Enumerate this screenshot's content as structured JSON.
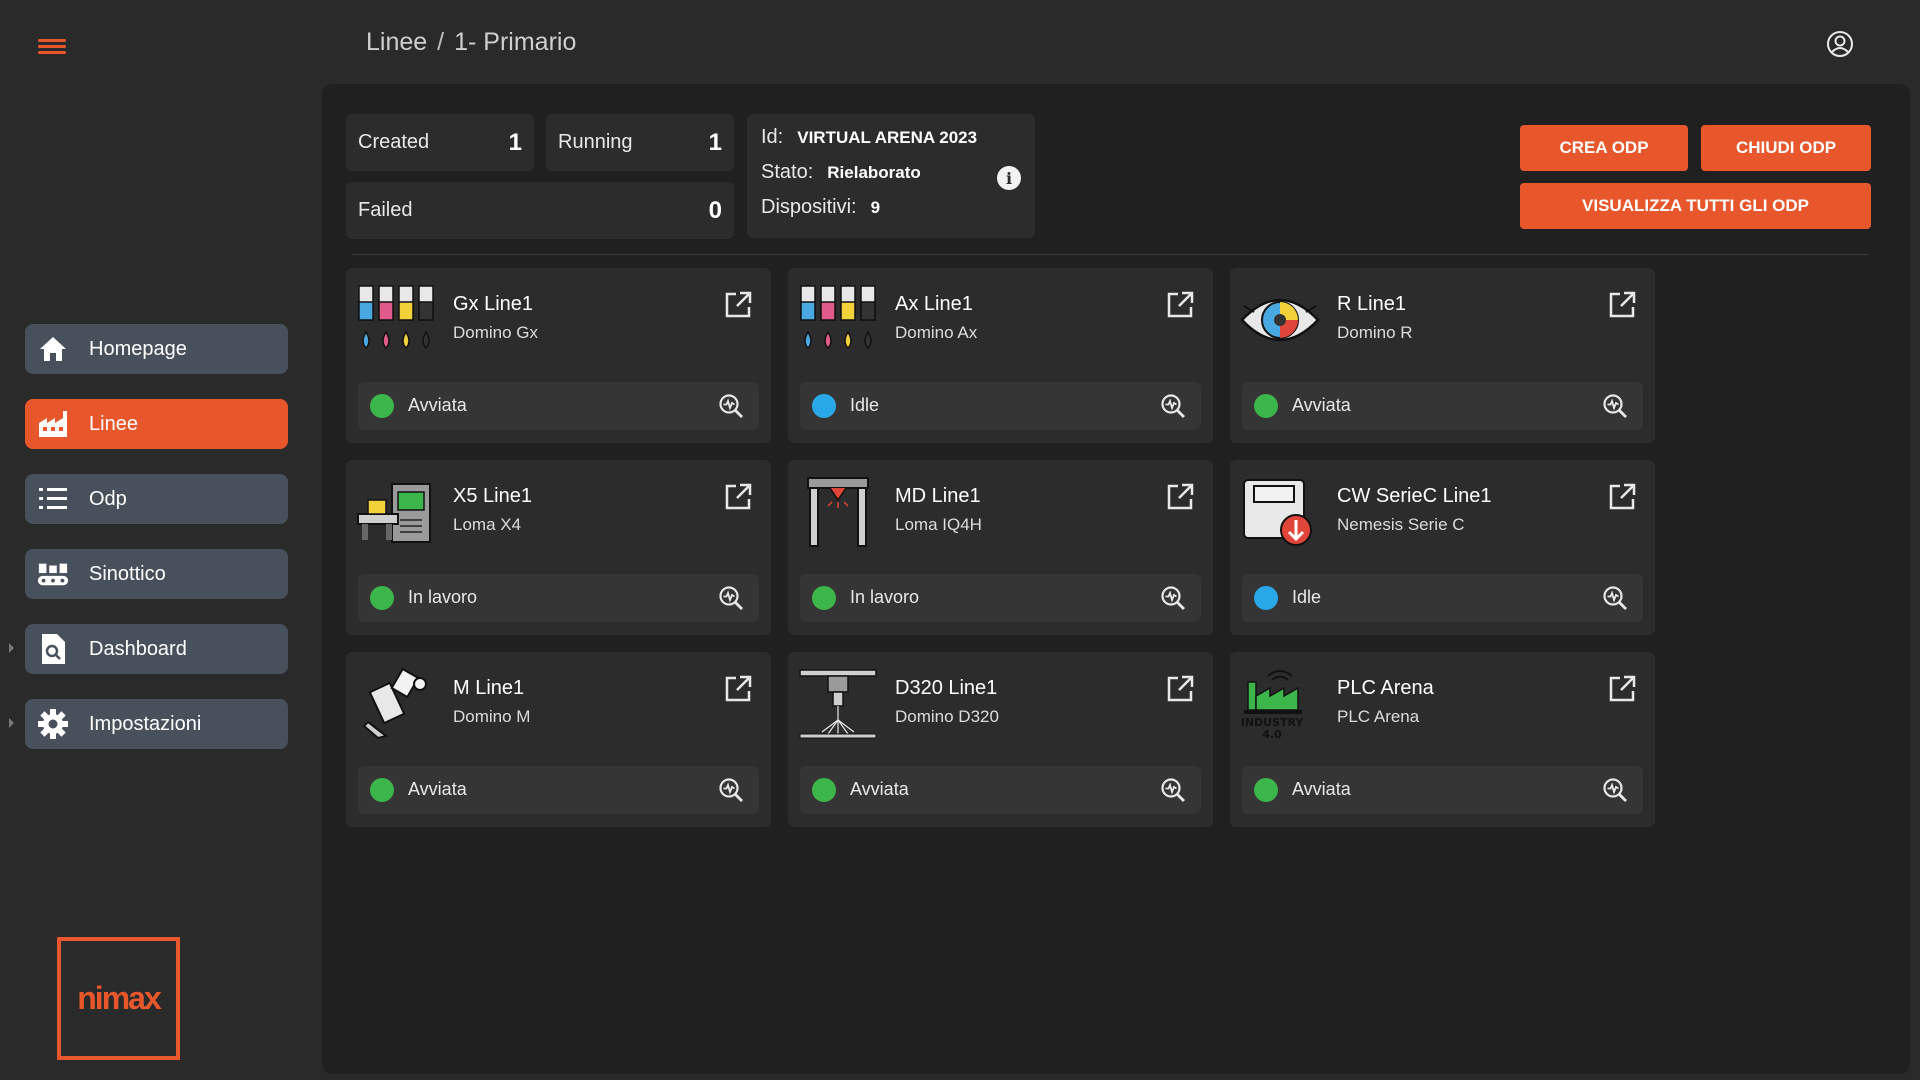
{
  "header": {
    "breadcrumb": [
      "Linee",
      "1- Primario"
    ],
    "separator": "/"
  },
  "sidebar": {
    "items": [
      {
        "label": "Homepage",
        "icon": "home-icon",
        "active": false
      },
      {
        "label": "Linee",
        "icon": "factory-icon",
        "active": true
      },
      {
        "label": "Odp",
        "icon": "list-icon",
        "active": false
      },
      {
        "label": "Sinottico",
        "icon": "conveyor-icon",
        "active": false
      },
      {
        "label": "Dashboard",
        "icon": "document-search-icon",
        "active": false
      },
      {
        "label": "Impostazioni",
        "icon": "gear-icon",
        "active": false
      }
    ],
    "logo_text": "nimax"
  },
  "stats": {
    "created": {
      "label": "Created",
      "value": "1"
    },
    "running": {
      "label": "Running",
      "value": "1"
    },
    "failed": {
      "label": "Failed",
      "value": "0"
    }
  },
  "info": {
    "id_label": "Id:",
    "id_value": "VIRTUAL ARENA 2023",
    "stato_label": "Stato:",
    "stato_value": "Rielaborato",
    "dispositivi_label": "Dispositivi:",
    "dispositivi_value": "9"
  },
  "actions": {
    "crea": "CREA ODP",
    "chiudi": "CHIUDI ODP",
    "visualizza": "VISUALIZZA TUTTI GLI ODP"
  },
  "devices": [
    {
      "name": "Gx Line1",
      "model": "Domino Gx",
      "status": "Avviata",
      "status_color": "#3cb54a",
      "icon": "ink-bottles-icon"
    },
    {
      "name": "Ax Line1",
      "model": "Domino Ax",
      "status": "Idle",
      "status_color": "#29a8e8",
      "icon": "ink-bottles-icon"
    },
    {
      "name": "R Line1",
      "model": "Domino R",
      "status": "Avviata",
      "status_color": "#3cb54a",
      "icon": "eye-vision-icon"
    },
    {
      "name": "X5 Line1",
      "model": "Loma X4",
      "status": "In lavoro",
      "status_color": "#3cb54a",
      "icon": "xray-machine-icon"
    },
    {
      "name": "MD Line1",
      "model": "Loma IQ4H",
      "status": "In lavoro",
      "status_color": "#3cb54a",
      "icon": "metal-detector-icon"
    },
    {
      "name": "CW SerieC Line1",
      "model": "Nemesis Serie C",
      "status": "Idle",
      "status_color": "#29a8e8",
      "icon": "checkweigher-icon"
    },
    {
      "name": "M Line1",
      "model": "Domino M",
      "status": "Avviata",
      "status_color": "#3cb54a",
      "icon": "laser-marker-icon"
    },
    {
      "name": "D320 Line1",
      "model": "Domino D320",
      "status": "Avviata",
      "status_color": "#3cb54a",
      "icon": "laser-scanner-icon"
    },
    {
      "name": "PLC Arena",
      "model": "PLC Arena",
      "status": "Avviata",
      "status_color": "#3cb54a",
      "icon": "industry-icon",
      "icon_text": "INDUSTRY",
      "icon_subtext": "4.0"
    }
  ],
  "colors": {
    "accent": "#e8572b",
    "background": "#2a2a2a",
    "panel": "#202020",
    "card": "#2c2c2c",
    "nav_item": "#48505c",
    "status_green": "#3cb54a",
    "status_blue": "#29a8e8"
  }
}
